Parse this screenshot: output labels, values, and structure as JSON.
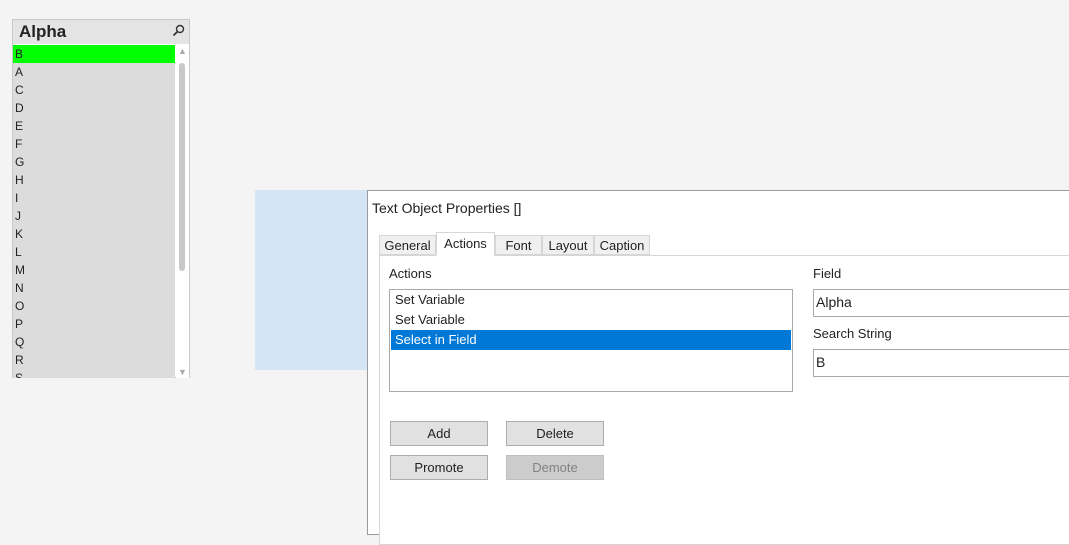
{
  "listbox": {
    "title": "Alpha",
    "items": [
      "B",
      "A",
      "C",
      "D",
      "E",
      "F",
      "G",
      "H",
      "I",
      "J",
      "K",
      "L",
      "M",
      "N",
      "O",
      "P",
      "Q",
      "R",
      "S"
    ],
    "selected": "B",
    "search_icon": "search-icon",
    "selected_color": "#00ff00"
  },
  "dialog": {
    "title": "Text Object Properties []",
    "tabs": [
      {
        "label": "General"
      },
      {
        "label": "Actions"
      },
      {
        "label": "Font"
      },
      {
        "label": "Layout"
      },
      {
        "label": "Caption"
      }
    ],
    "active_tab": "Actions",
    "actions_label": "Actions",
    "actions": [
      {
        "label": "Set Variable"
      },
      {
        "label": "Set Variable"
      },
      {
        "label": "Select in Field"
      }
    ],
    "selected_action": "Select in Field",
    "field_label": "Field",
    "field_value": "Alpha",
    "search_string_label": "Search String",
    "search_string_value": "B",
    "ellipsis": "...",
    "buttons": {
      "add": "Add",
      "delete": "Delete",
      "promote": "Promote",
      "demote": "Demote"
    },
    "accent_color": "#0078d7"
  }
}
